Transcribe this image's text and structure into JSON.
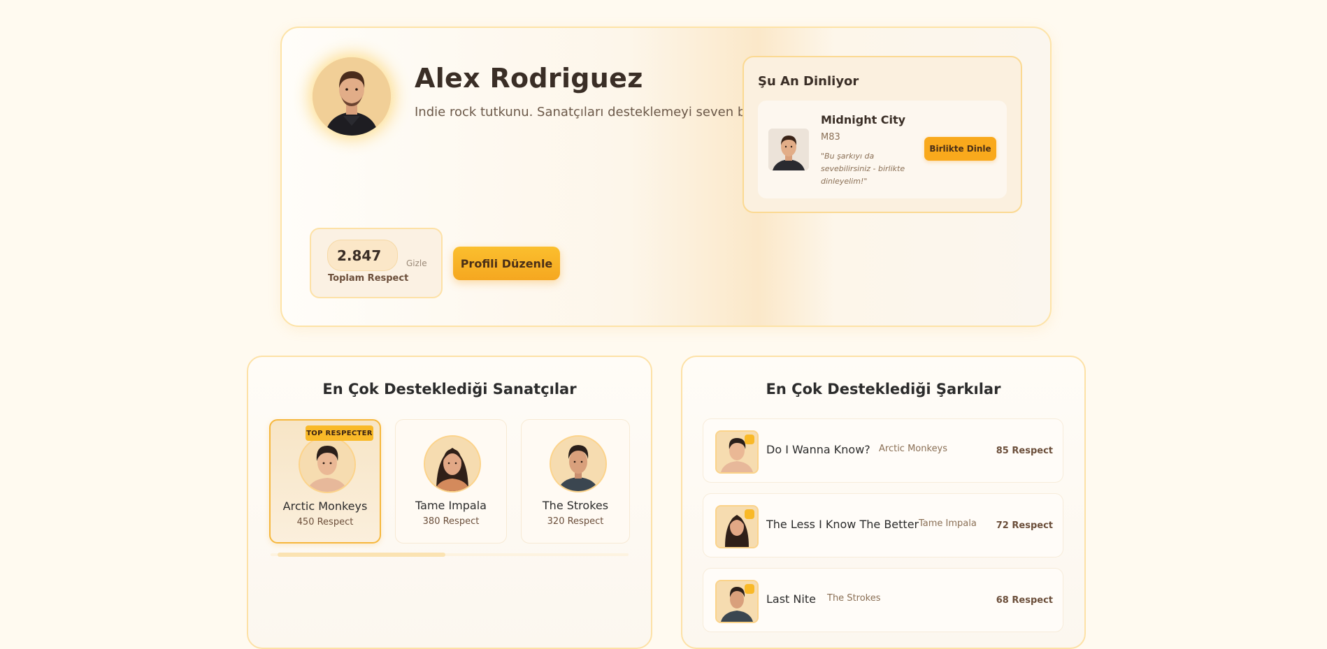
{
  "profile": {
    "name": "Alex Rodriguez",
    "bio": "Indie rock tutkunu. Sanatçıları desteklemeyi seven biri.",
    "respect_value": "2.847",
    "respect_label": "Toplam Respect",
    "hide_label": "Gizle",
    "edit_label": "Profili Düzenle"
  },
  "now_playing": {
    "title": "Şu An Dinliyor",
    "track": "Midnight City",
    "artist": "M83",
    "note": "\"Bu şarkıyı da sevebilirsiniz - birlikte dinleyelim!\"",
    "button": "Birlikte Dinle"
  },
  "artists": {
    "title": "En Çok Desteklediği Sanatçılar",
    "badge": "TOP RESPECTER",
    "items": [
      {
        "name": "Arctic Monkeys",
        "respect": "450 Respect"
      },
      {
        "name": "Tame Impala",
        "respect": "380 Respect"
      },
      {
        "name": "The Strokes",
        "respect": "320 Respect"
      }
    ]
  },
  "songs": {
    "title": "En Çok Desteklediği Şarkılar",
    "items": [
      {
        "name": "Do I Wanna Know?",
        "artist": "Arctic Monkeys",
        "respect": "85 Respect"
      },
      {
        "name": "The Less I Know The Better",
        "artist": "Tame Impala",
        "respect": "72 Respect"
      },
      {
        "name": "Last Nite",
        "artist": "The Strokes",
        "respect": "68 Respect"
      }
    ]
  },
  "colors": {
    "accent": "#f9a91c",
    "background": "#fffaf0",
    "border": "#fde1a6"
  }
}
